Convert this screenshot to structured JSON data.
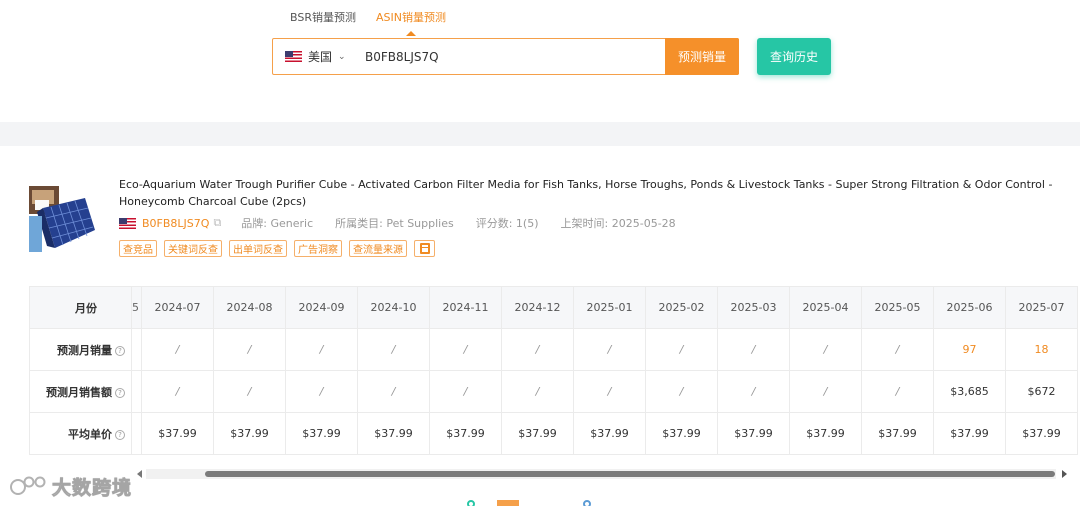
{
  "tabs": [
    "BSR销量预测",
    "ASIN销量预测"
  ],
  "search": {
    "country": "美国",
    "asin_value": "B0FB8LJS7Q",
    "predict_label": "预测销量",
    "history_label": "查询历史"
  },
  "product": {
    "title": "Eco-Aquarium Water Trough Purifier Cube - Activated Carbon Filter Media for Fish Tanks, Horse Troughs, Ponds & Livestock Tanks - Super Strong Filtration & Odor Control - Honeycomb Charcoal Cube (2pcs)",
    "asin": "B0FB8LJS7Q",
    "brand": "品牌: Generic",
    "category": "所属类目: Pet Supplies",
    "rating": "评分数: 1(5)",
    "listed": "上架时间: 2025-05-28",
    "tags": [
      "查竞品",
      "关键词反查",
      "出单词反查",
      "广告洞察",
      "查流量来源"
    ]
  },
  "table": {
    "month_header": "月份",
    "frag_header": "5",
    "months": [
      "2024-07",
      "2024-08",
      "2024-09",
      "2024-10",
      "2024-11",
      "2024-12",
      "2025-01",
      "2025-02",
      "2025-03",
      "2025-04",
      "2025-05",
      "2025-06",
      "2025-07"
    ],
    "rows": [
      {
        "label": "预测月销量",
        "values": [
          "/",
          "/",
          "/",
          "/",
          "/",
          "/",
          "/",
          "/",
          "/",
          "/",
          "/",
          "97",
          "18"
        ]
      },
      {
        "label": "预测月销售额",
        "values": [
          "/",
          "/",
          "/",
          "/",
          "/",
          "/",
          "/",
          "/",
          "/",
          "/",
          "/",
          "$3,685",
          "$672"
        ]
      },
      {
        "label": "平均单价",
        "values": [
          "$37.99",
          "$37.99",
          "$37.99",
          "$37.99",
          "$37.99",
          "$37.99",
          "$37.99",
          "$37.99",
          "$37.99",
          "$37.99",
          "$37.99",
          "$37.99",
          "$37.99"
        ]
      }
    ]
  },
  "watermark": "大数跨境",
  "colors": {
    "accent": "#f08b22",
    "teal": "#26c6a5"
  }
}
